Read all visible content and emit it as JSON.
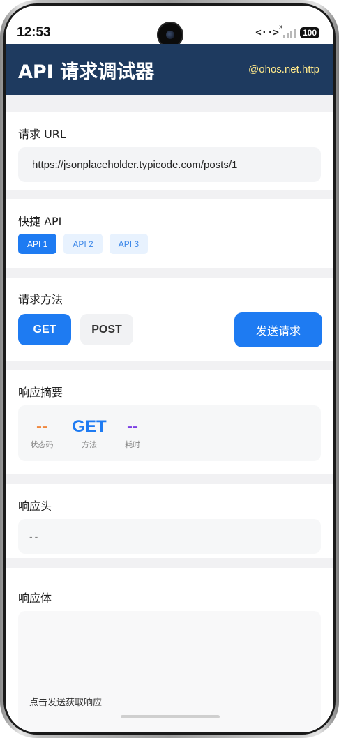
{
  "status_bar": {
    "time": "12:53",
    "network_glyph": "<··>",
    "signal_x": "x",
    "battery": "100"
  },
  "header": {
    "title": "API 请求调试器",
    "subtitle": "@ohos.net.http"
  },
  "url_section": {
    "title": "请求 URL",
    "value": "https://jsonplaceholder.typicode.com/posts/1"
  },
  "quick_api": {
    "title": "快捷 API",
    "items": [
      "API 1",
      "API 2",
      "API 3"
    ],
    "selected_index": 0
  },
  "method_section": {
    "title": "请求方法",
    "methods": [
      "GET",
      "POST"
    ],
    "selected": "GET",
    "send_label": "发送请求"
  },
  "summary": {
    "title": "响应摘要",
    "status_value": "--",
    "status_label": "状态码",
    "method_value": "GET",
    "method_label": "方法",
    "time_value": "--",
    "time_label": "耗时"
  },
  "response_headers": {
    "title": "响应头",
    "value": "--"
  },
  "response_body": {
    "title": "响应体",
    "placeholder": "点击发送获取响应"
  },
  "colors": {
    "header_bg": "#1e3a5f",
    "subtitle": "#ffe98a",
    "accent": "#1e7bf2",
    "status_orange": "#f0883e",
    "method_blue": "#1e7bf2",
    "time_purple": "#7b3fe4"
  }
}
